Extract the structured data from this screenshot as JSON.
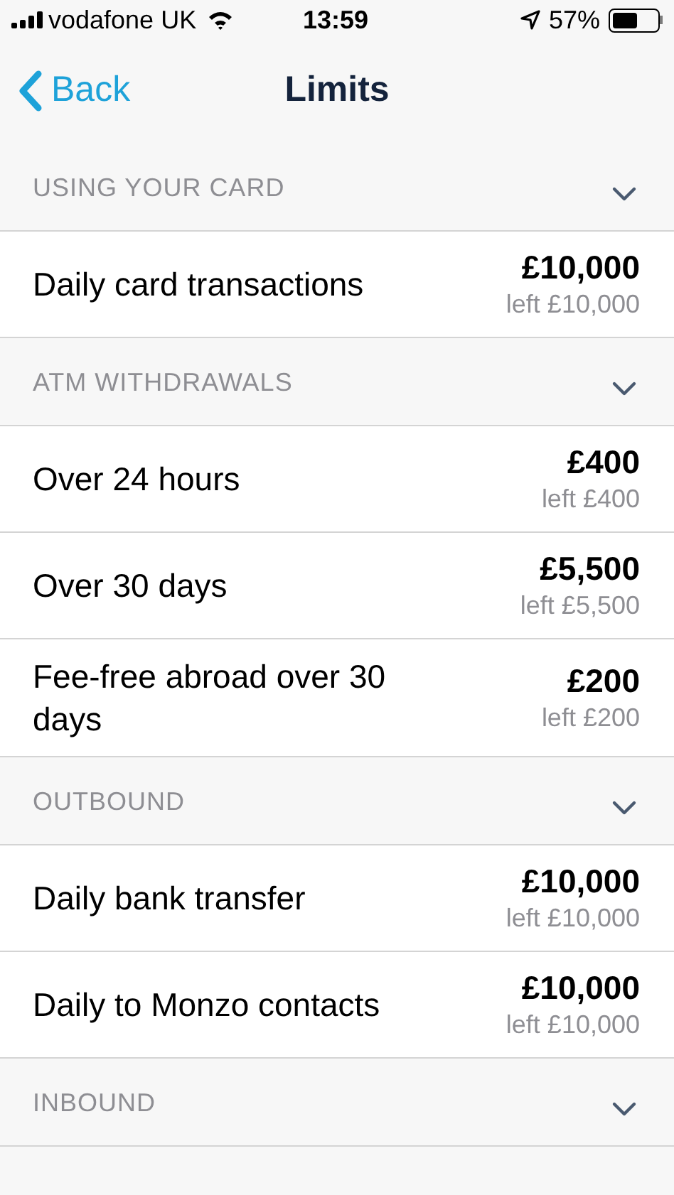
{
  "status_bar": {
    "carrier": "vodafone UK",
    "time": "13:59",
    "battery": "57%"
  },
  "nav": {
    "back": "Back",
    "title": "Limits"
  },
  "sections": [
    {
      "title": "USING YOUR CARD",
      "expanded": true,
      "rows": [
        {
          "label": "Daily card transactions",
          "amount": "£10,000",
          "left": "left £10,000"
        }
      ]
    },
    {
      "title": "ATM WITHDRAWALS",
      "expanded": true,
      "rows": [
        {
          "label": "Over 24 hours",
          "amount": "£400",
          "left": "left £400"
        },
        {
          "label": "Over 30 days",
          "amount": "£5,500",
          "left": "left £5,500"
        },
        {
          "label": "Fee-free abroad over 30 days",
          "amount": "£200",
          "left": "left £200"
        }
      ]
    },
    {
      "title": "OUTBOUND",
      "expanded": true,
      "rows": [
        {
          "label": "Daily bank transfer",
          "amount": "£10,000",
          "left": "left £10,000"
        },
        {
          "label": "Daily to Monzo contacts",
          "amount": "£10,000",
          "left": "left £10,000"
        }
      ]
    },
    {
      "title": "INBOUND",
      "expanded": true
    }
  ]
}
